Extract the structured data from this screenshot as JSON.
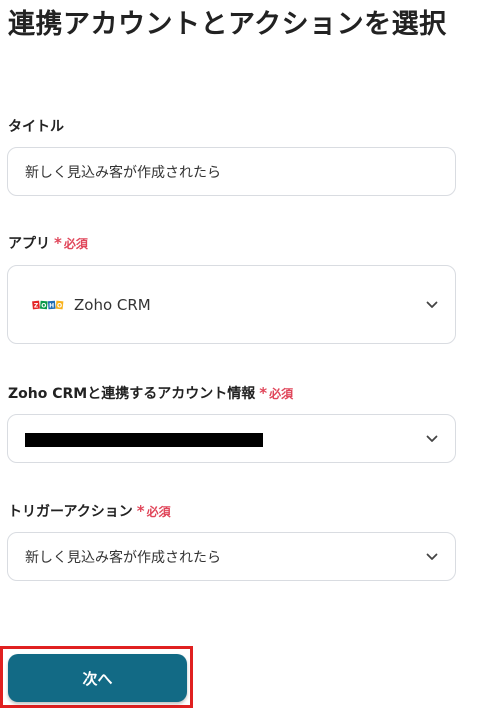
{
  "page": {
    "title": "連携アカウントとアクションを選択"
  },
  "fields": {
    "title": {
      "label": "タイトル",
      "value": "新しく見込み客が作成されたら"
    },
    "app": {
      "label": "アプリ",
      "required_mark": "*",
      "required_text": "必須",
      "value": "Zoho CRM",
      "logo_text": "ZOHO",
      "logo_icon": "zoho-logo-icon"
    },
    "account": {
      "label": "Zoho CRMと連携するアカウント情報",
      "required_mark": "*",
      "required_text": "必須",
      "value_redacted": true
    },
    "trigger": {
      "label": "トリガーアクション",
      "required_mark": "*",
      "required_text": "必須",
      "value": "新しく見込み客が作成されたら"
    }
  },
  "actions": {
    "next_label": "次へ"
  },
  "colors": {
    "required": "#e0465a",
    "primary_button": "#126a85",
    "highlight_outline": "#e02020",
    "border": "#d9dce1"
  }
}
